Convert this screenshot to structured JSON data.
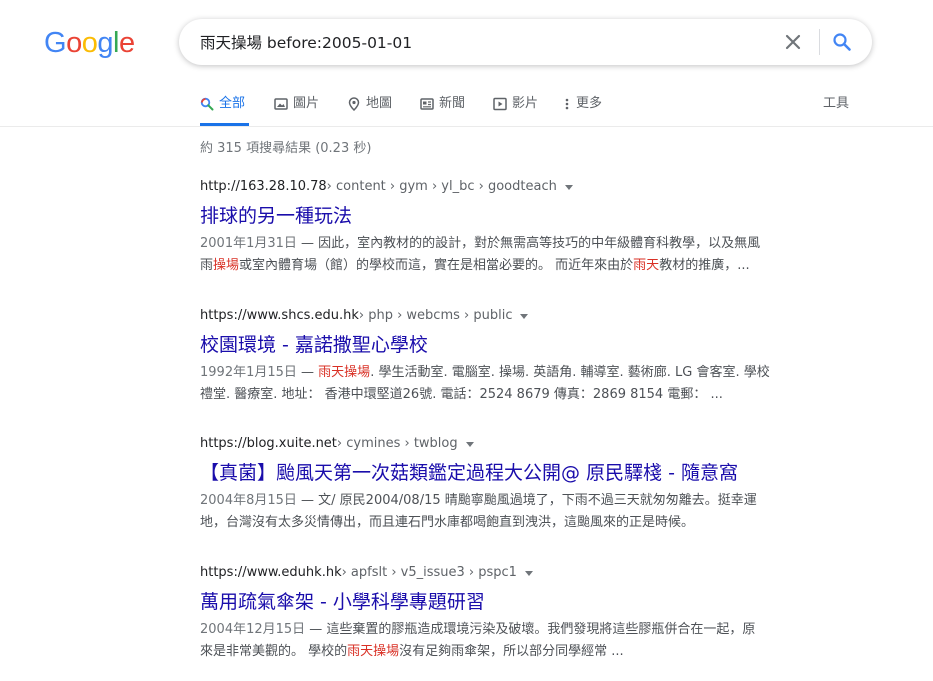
{
  "search": {
    "query": "雨天操場 before:2005-01-01",
    "clear_icon": "close-icon",
    "search_icon": "search-icon"
  },
  "logo": {
    "letters": [
      "G",
      "o",
      "o",
      "g",
      "l",
      "e"
    ],
    "colors": [
      "#4285f4",
      "#ea4335",
      "#fbbc05",
      "#4285f4",
      "#34a853",
      "#ea4335"
    ]
  },
  "tabs": [
    {
      "label": "全部",
      "icon": "search-icon",
      "active": true
    },
    {
      "label": "圖片",
      "icon": "image-icon"
    },
    {
      "label": "地圖",
      "icon": "map-pin-icon"
    },
    {
      "label": "新聞",
      "icon": "newspaper-icon"
    },
    {
      "label": "影片",
      "icon": "video-icon"
    },
    {
      "label": "更多",
      "icon": "more-vert-icon"
    }
  ],
  "tools_label": "工具",
  "stats": "約 315 項搜尋結果 (0.23 秒)",
  "results": [
    {
      "domain": "http://163.28.10.78",
      "crumbs": " › content › gym › yl_bc › goodteach",
      "title": "排球的另一種玩法",
      "date": "2001年1月31日",
      "line1": " — 因此，室內教材的的設計，對於無需高等技巧的中年級體育科教學，以及無風",
      "line2a": "雨",
      "hl2a": "操場",
      "line2b": "或室內體育場（館）的學校而這，實在是相當必要的。 而近年來由於",
      "hl2b": "雨天",
      "line2c": "教材的推廣，..."
    },
    {
      "domain": "https://www.shcs.edu.hk",
      "crumbs": " › php › webcms › public",
      "title": "校園環境 - 嘉諾撒聖心學校",
      "date": "1992年1月15日",
      "line1a": " — ",
      "hl1": "雨天操場",
      "line1b": ". 學生活動室. 電腦室. 操場. 英語角. 輔導室. 藝術廊. LG 會客室. 學校",
      "line2": "禮堂. 醫療室. 地址： 香港中環堅道26號. 電話：2524 8679 傳真：2869 8154 電郵： ..."
    },
    {
      "domain": "https://blog.xuite.net",
      "crumbs": " › cymines › twblog",
      "title": "【真菌】颱風天第一次菇類鑑定過程大公開@ 原民驛棧 - 隨意窩",
      "date": "2004年8月15日",
      "line1": " — 文/ 原民2004/08/15 晴颱寧颱風過境了，下雨不過三天就匆匆離去。挺幸運",
      "line2": "地，台灣沒有太多災情傳出，而且連石門水庫都喝飽直到洩洪，這颱風來的正是時候。"
    },
    {
      "domain": "https://www.eduhk.hk",
      "crumbs": " › apfslt › v5_issue3 › pspc1",
      "title": "萬用疏氣傘架 - 小學科學專題研習",
      "date": "2004年12月15日",
      "line1": " — 這些棄置的膠瓶造成環境污染及破壞。我們發現將這些膠瓶併合在一起，原",
      "line2a": "來是非常美觀的。 學校的",
      "hl2": "雨天操場",
      "line2b": "沒有足夠雨傘架，所以部分同學經常 ..."
    }
  ]
}
